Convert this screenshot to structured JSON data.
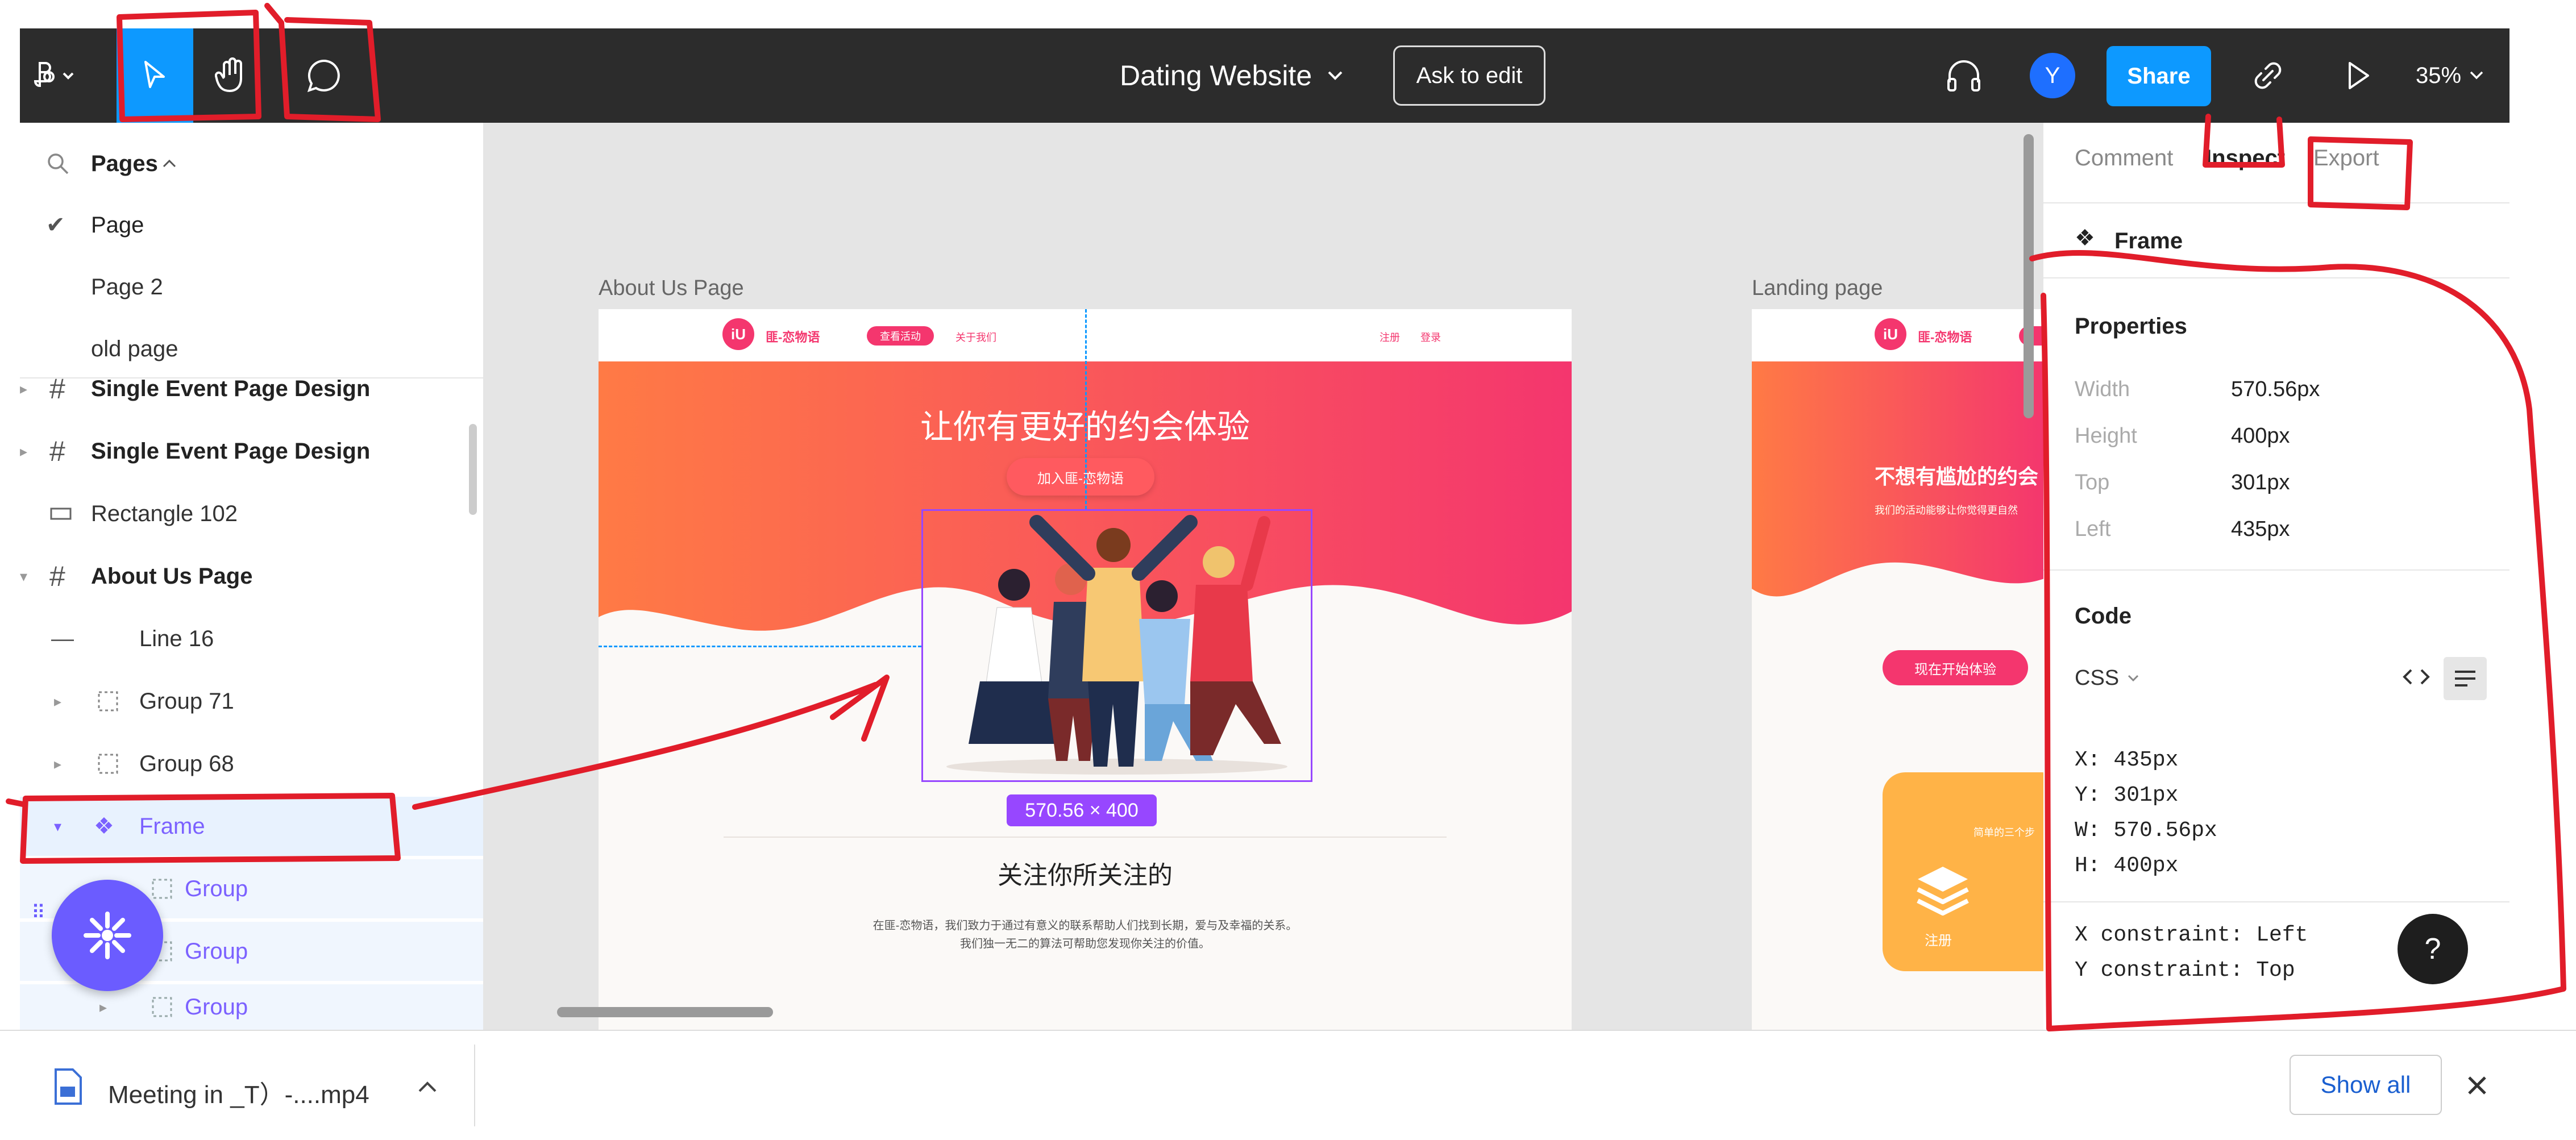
{
  "toolbar": {
    "file_title": "Dating Website",
    "ask_to_edit": "Ask to edit",
    "avatar_initial": "Y",
    "share": "Share",
    "zoom": "35%"
  },
  "pages_panel": {
    "header": "Pages",
    "pages": [
      "Page",
      "Page 2",
      "old page"
    ]
  },
  "layers": [
    {
      "label": "Single Event Page Design",
      "type": "frame"
    },
    {
      "label": "Single Event Page Design",
      "type": "frame"
    },
    {
      "label": "Rectangle 102",
      "type": "rectangle"
    },
    {
      "label": "About Us Page",
      "type": "frame"
    },
    {
      "label": "Line 16",
      "type": "line"
    },
    {
      "label": "Group 71",
      "type": "group"
    },
    {
      "label": "Group 68",
      "type": "group"
    },
    {
      "label": "Frame",
      "type": "component"
    },
    {
      "label": "Group",
      "type": "group"
    },
    {
      "label": "Group",
      "type": "group"
    },
    {
      "label": "Group",
      "type": "group"
    }
  ],
  "canvas": {
    "about_label": "About Us Page",
    "landing_label": "Landing page",
    "about": {
      "logo_icon": "iU",
      "logo_text": "匪-恋物语",
      "nav_pill": "查看活动",
      "nav_link": "关于我们",
      "nav_right_1": "注册",
      "nav_right_2": "登录",
      "hero_title": "让你有更好的约会体验",
      "hero_button": "加入匪-恋物语",
      "selection_size": "570.56 × 400",
      "section_title": "关注你所关注的",
      "para_line1": "在匪-恋物语，我们致力于通过有意义的联系帮助人们找到长期，爱与及幸福的关系。",
      "para_line2": "我们独一无二的算法可帮助您发现你关注的价值。"
    },
    "landing": {
      "logo_icon": "iU",
      "logo_text": "匪-恋物语",
      "hero_title": "不想有尴尬的约会",
      "hero_sub": "我们的活动能够让你觉得更自然",
      "cta": "现在开始体验",
      "card_text": "简单的三个步",
      "card_label": "注册"
    }
  },
  "inspect": {
    "tabs": [
      "Comment",
      "Inspect",
      "Export"
    ],
    "active_tab": "Inspect",
    "layer_name": "Frame",
    "properties_title": "Properties",
    "props": [
      {
        "label": "Width",
        "value": "570.56px"
      },
      {
        "label": "Height",
        "value": "400px"
      },
      {
        "label": "Top",
        "value": "301px"
      },
      {
        "label": "Left",
        "value": "435px"
      }
    ],
    "code_title": "Code",
    "code_lang": "CSS",
    "code_lines": [
      "X: 435px",
      "Y: 301px",
      "W: 570.56px",
      "H: 400px"
    ],
    "constraints": [
      "X constraint: Left",
      "Y constraint: Top"
    ],
    "help": "?"
  },
  "download_bar": {
    "file_name": "Meeting in _T）-....mp4",
    "show_all": "Show all"
  },
  "colors": {
    "toolbar_bg": "#2c2c2c",
    "accent_blue": "#0d99ff",
    "selection_purple": "#9747ff",
    "hero_pink": "#f4366e",
    "hero_orange": "#ff7a45",
    "annotation_red": "#e11d2a",
    "canvas_bg": "#e5e5e5"
  }
}
